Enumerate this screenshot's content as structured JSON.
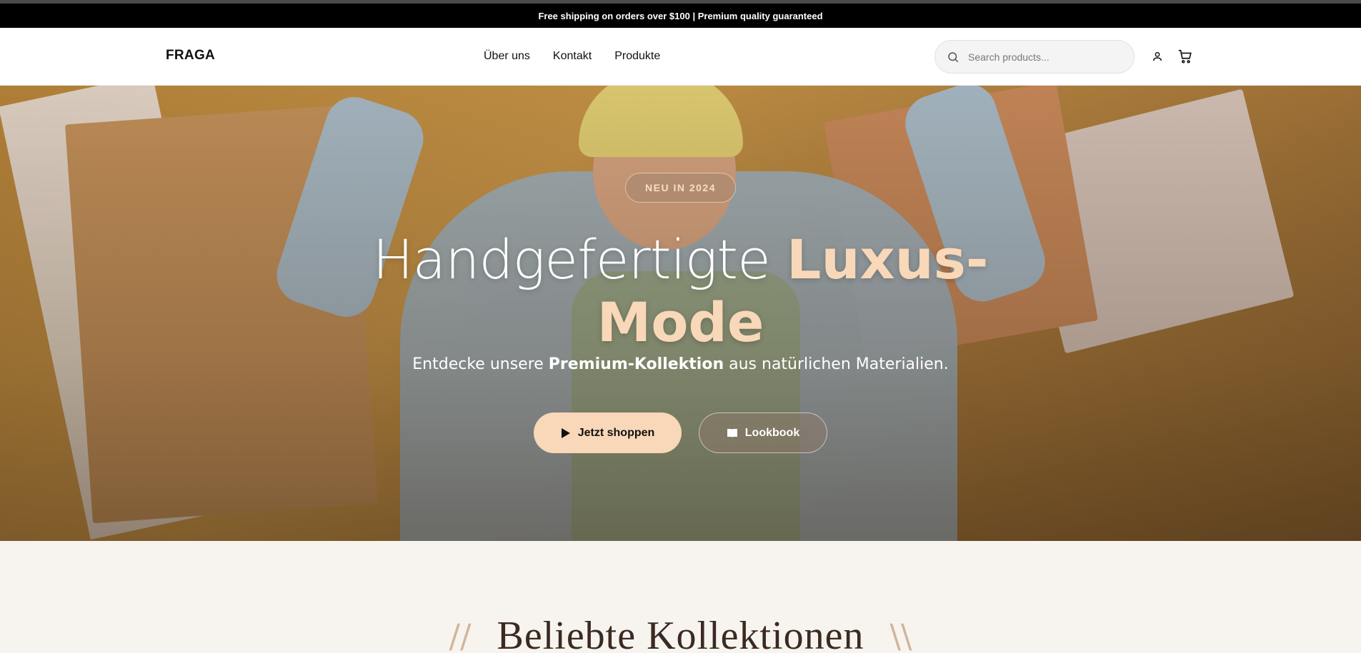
{
  "announcement": {
    "text": "Free shipping on orders over $100 | Premium quality guaranteed"
  },
  "header": {
    "logo": "FRAGA",
    "nav": [
      {
        "label": "Über uns"
      },
      {
        "label": "Kontakt"
      },
      {
        "label": "Produkte"
      }
    ],
    "search": {
      "placeholder": "Search products...",
      "value": ""
    },
    "icons": [
      "search-icon",
      "user-icon",
      "cart-icon"
    ]
  },
  "hero": {
    "badge": "NEU IN 2024",
    "headline_light": "Handgefertigte ",
    "headline_accent_1": "Luxus-",
    "headline_accent_2": "Mode",
    "sub_before": "Entdecke unsere ",
    "sub_bold": "Premium-Kollektion",
    "sub_after": " aus natürlichen Materialien.",
    "primary_button": "Jetzt shoppen",
    "secondary_button": "Lookbook",
    "colors": {
      "accent": "#f8d8b8",
      "background": "#c79447"
    }
  },
  "section": {
    "title": "Beliebte Kollektionen",
    "deco_left": "//",
    "deco_right": "\\\\"
  },
  "colors": {
    "announcement_bg": "#000000",
    "page_bg": "#f7f4ef",
    "title_color": "#3a2a22"
  }
}
